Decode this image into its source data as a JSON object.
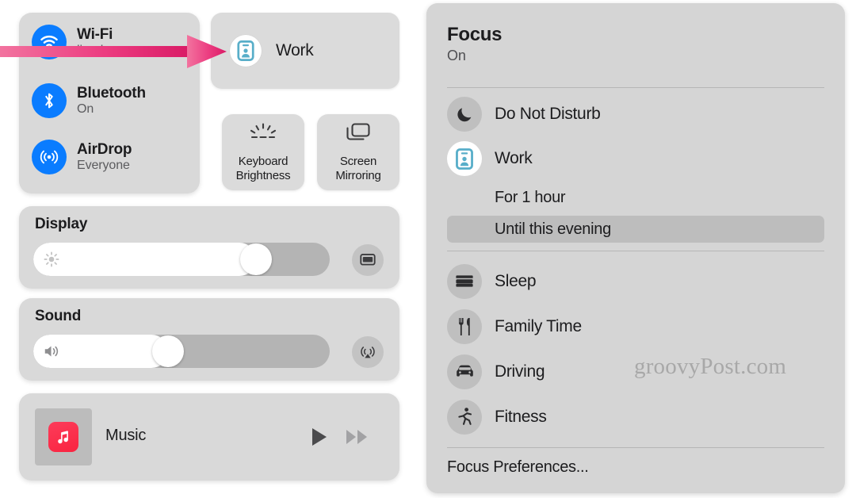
{
  "control_center": {
    "connectivity": [
      {
        "icon": "wifi-icon",
        "title": "Wi-Fi",
        "subtitle": "lion-luma"
      },
      {
        "icon": "bluetooth-icon",
        "title": "Bluetooth",
        "subtitle": "On"
      },
      {
        "icon": "airdrop-icon",
        "title": "AirDrop",
        "subtitle": "Everyone"
      }
    ],
    "focus_tile": {
      "icon": "work-badge-icon",
      "label": "Work"
    },
    "mini_tiles": [
      {
        "icon": "keyboard-brightness-icon",
        "line1": "Keyboard",
        "line2": "Brightness"
      },
      {
        "icon": "screen-mirroring-icon",
        "line1": "Screen",
        "line2": "Mirroring"
      }
    ],
    "display": {
      "title": "Display",
      "icon": "brightness-sun-icon",
      "value_percent": 78,
      "side_button_icon": "display-monitor-icon"
    },
    "sound": {
      "title": "Sound",
      "icon": "speaker-wave-icon",
      "value_percent": 45,
      "side_button_icon": "airplay-audio-icon"
    },
    "music": {
      "app_icon": "music-note-icon",
      "title": "Music",
      "play_icon": "play-icon",
      "next_icon": "fast-forward-icon"
    }
  },
  "focus_panel": {
    "title": "Focus",
    "status": "On",
    "modes": [
      {
        "icon": "moon-icon",
        "label": "Do Not Disturb",
        "active": false
      },
      {
        "icon": "work-badge-icon",
        "label": "Work",
        "active": true
      },
      {
        "icon": "bed-icon",
        "label": "Sleep",
        "active": false
      },
      {
        "icon": "fork-knife-icon",
        "label": "Family Time",
        "active": false
      },
      {
        "icon": "car-icon",
        "label": "Driving",
        "active": false
      },
      {
        "icon": "running-icon",
        "label": "Fitness",
        "active": false
      }
    ],
    "duration_options": [
      {
        "label": "For 1 hour",
        "selected": false
      },
      {
        "label": "Until this evening",
        "selected": true
      }
    ],
    "preferences_label": "Focus Preferences..."
  },
  "annotation": {
    "arrow_color_start": "#f06090",
    "arrow_color_end": "#e01f6e"
  },
  "watermark": {
    "text": "groovyPost.com"
  },
  "colors": {
    "page_background": "#ffffff",
    "panel_background": "#d9d9d9",
    "focus_panel_background": "#d5d5d5",
    "accent_blue": "#0a7cff",
    "work_teal": "#58aec9",
    "music_red": "#fa2440",
    "selected_row": "#bdbdbd"
  }
}
